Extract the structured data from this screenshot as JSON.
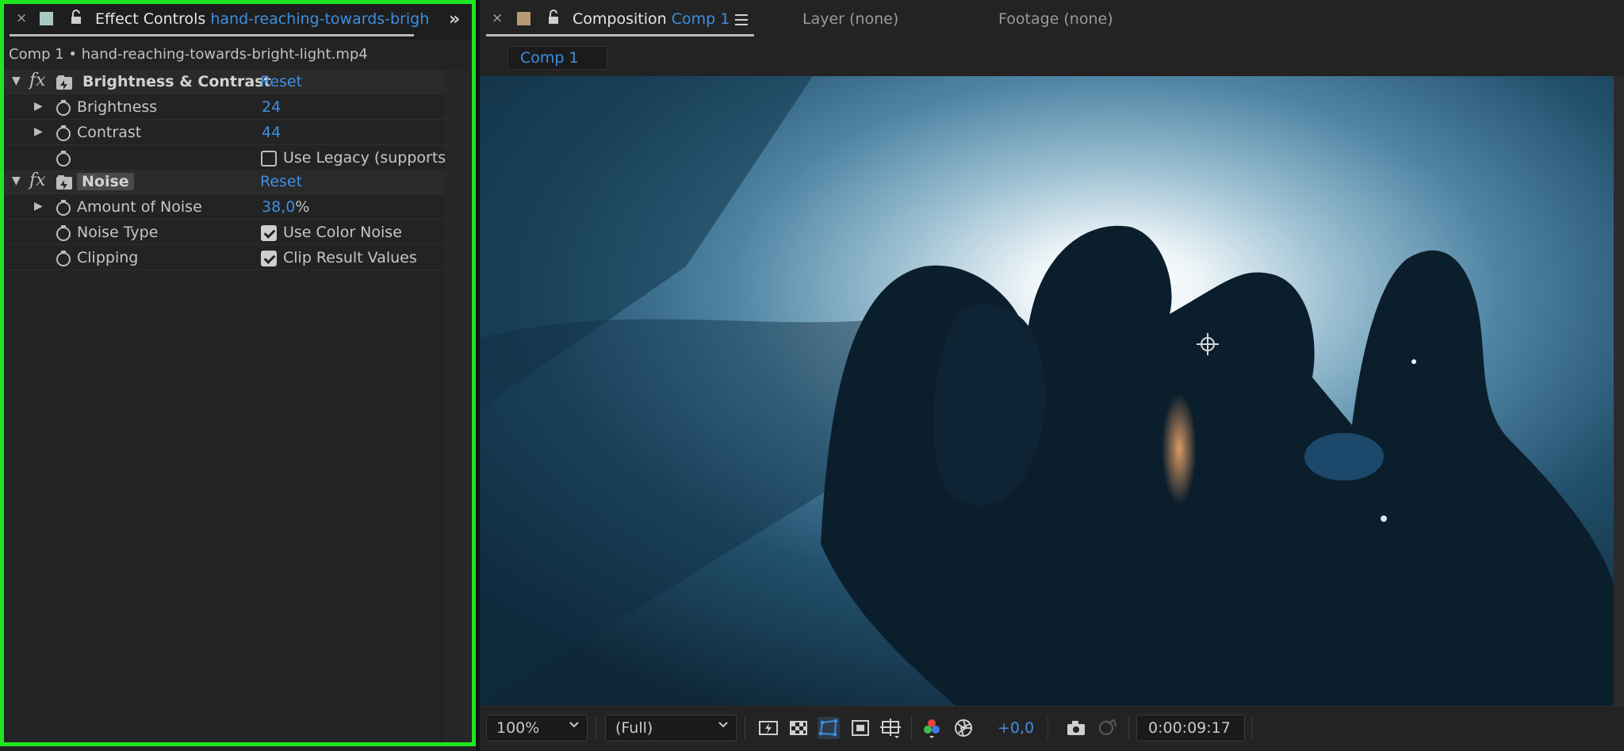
{
  "effect_controls": {
    "close": "×",
    "panel_label": "Effect Controls",
    "layer_name": "hand-reaching-towards-brigh",
    "subtitle": "Comp 1 • hand-reaching-towards-bright-light.mp4",
    "label_color": "#a8c8c4",
    "effects": [
      {
        "name": "Brightness & Contrast",
        "reset": "Reset",
        "properties": [
          {
            "name": "Brightness",
            "value": "24"
          },
          {
            "name": "Contrast",
            "value": "44"
          },
          {
            "name": "",
            "checkbox_label": "Use Legacy (supports",
            "checked": false
          }
        ]
      },
      {
        "name": "Noise",
        "reset": "Reset",
        "properties": [
          {
            "name": "Amount of Noise",
            "value": "38,0",
            "unit": "%"
          },
          {
            "name": "Noise Type",
            "checkbox_label": "Use Color Noise",
            "checked": true
          },
          {
            "name": "Clipping",
            "checkbox_label": "Clip Result Values",
            "checked": true
          }
        ]
      }
    ]
  },
  "composition": {
    "close": "×",
    "panel_label": "Composition",
    "comp_name": "Comp 1",
    "label_color": "#b89a74",
    "layer_tab": "Layer (none)",
    "footage_tab": "Footage (none)",
    "subtab": "Comp 1"
  },
  "viewer_bar": {
    "zoom": "100%",
    "resolution": "(Full)",
    "exposure": "+0,0",
    "timecode": "0:00:09:17"
  },
  "colors": {
    "accent_blue": "#3d8fe0",
    "highlight_green": "#1fe61f"
  }
}
